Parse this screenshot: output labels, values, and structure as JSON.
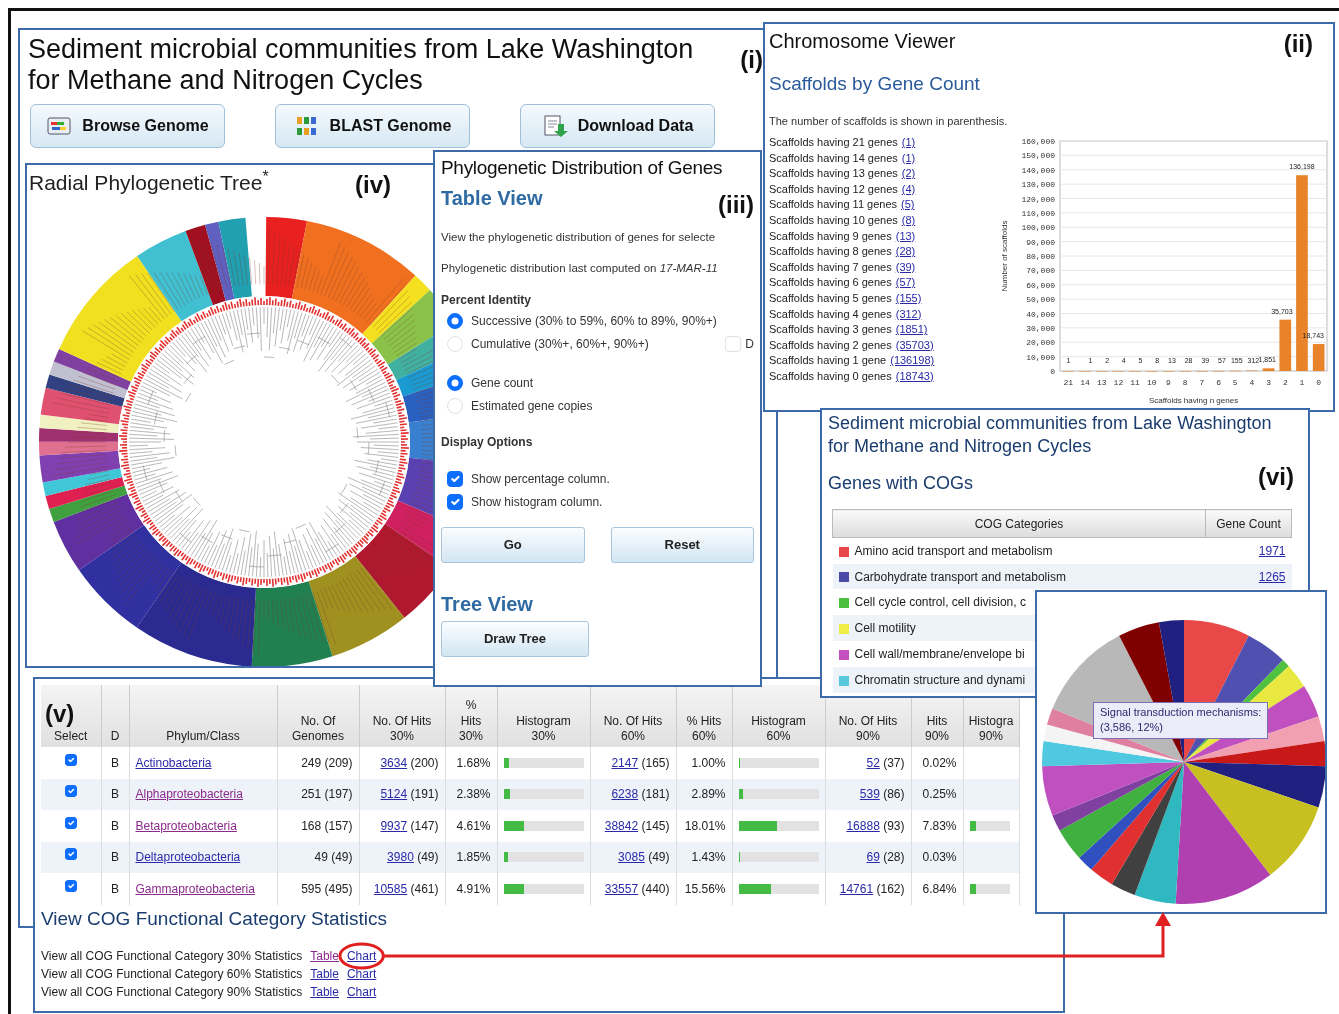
{
  "genome_panel": {
    "title_lines": [
      "Sediment microbial communities from Lake Washington",
      "for Methane and Nitrogen Cycles"
    ],
    "label": "(i)",
    "buttons": [
      {
        "label": "Browse Genome",
        "kind": "browse"
      },
      {
        "label": "BLAST Genome",
        "kind": "blast"
      },
      {
        "label": "Download Data",
        "kind": "download"
      }
    ]
  },
  "radial_tree": {
    "title": "Radial Phylogenetic Tree$^{*}$",
    "label": "(iv)"
  },
  "chromosome_viewer": {
    "title": "Chromosome Viewer",
    "label": "(ii)",
    "heading": "Scaffolds by Gene Count",
    "note": "The number of scaffolds is shown in parenthesis.",
    "scaffolds": [
      {
        "text": "Scaffolds having 21 genes",
        "count": "(1)"
      },
      {
        "text": "Scaffolds having 14 genes",
        "count": "(1)"
      },
      {
        "text": "Scaffolds having 13 genes",
        "count": "(2)"
      },
      {
        "text": "Scaffolds having 12 genes",
        "count": "(4)"
      },
      {
        "text": "Scaffolds having 11 genes",
        "count": "(5)"
      },
      {
        "text": "Scaffolds having 10 genes",
        "count": "(8)"
      },
      {
        "text": "Scaffolds having 9 genes",
        "count": "(13)"
      },
      {
        "text": "Scaffolds having 8 genes",
        "count": "(28)"
      },
      {
        "text": "Scaffolds having 7 genes",
        "count": "(39)"
      },
      {
        "text": "Scaffolds having 6 genes",
        "count": "(57)"
      },
      {
        "text": "Scaffolds having 5 genes",
        "count": "(155)"
      },
      {
        "text": "Scaffolds having 4 genes",
        "count": "(312)"
      },
      {
        "text": "Scaffolds having 3 genes",
        "count": "(1851)"
      },
      {
        "text": "Scaffolds having 2 genes",
        "count": "(35703)"
      },
      {
        "text": "Scaffolds having 1 gene",
        "count": "(136198)"
      },
      {
        "text": "Scaffolds having 0 genes",
        "count": "(18743)"
      }
    ],
    "chart_data": {
      "type": "bar",
      "xlabel": "Scaffolds having n genes",
      "ylabel": "Number of scaffolds",
      "categories": [
        "21",
        "14",
        "13",
        "12",
        "11",
        "10",
        "9",
        "8",
        "7",
        "6",
        "5",
        "4",
        "3",
        "2",
        "1",
        "0"
      ],
      "values": [
        1,
        1,
        2,
        4,
        5,
        8,
        13,
        28,
        39,
        57,
        155,
        312,
        1851,
        35703,
        136198,
        18743
      ],
      "ylim": [
        0,
        160000
      ],
      "grid": true,
      "yticks": [
        {
          "value": 0,
          "label": "0"
        },
        {
          "value": 10000,
          "label": "10,000"
        },
        {
          "value": 20000,
          "label": "20,000"
        },
        {
          "value": 30000,
          "label": "30,000"
        },
        {
          "value": 40000,
          "label": "40,000"
        },
        {
          "value": 50000,
          "label": "50,000"
        },
        {
          "value": 60000,
          "label": "60,000"
        },
        {
          "value": 70000,
          "label": "70,000"
        },
        {
          "value": 80000,
          "label": "80,000"
        },
        {
          "value": 90000,
          "label": "90,000"
        },
        {
          "value": 100000,
          "label": "100,000"
        },
        {
          "value": 110000,
          "label": "110,000"
        },
        {
          "value": 120000,
          "label": "120,000"
        },
        {
          "value": 130000,
          "label": "130,000"
        },
        {
          "value": 140000,
          "label": "140,000"
        },
        {
          "value": 150000,
          "label": "150,000"
        },
        {
          "value": 160000,
          "label": "160,000"
        }
      ],
      "value_labels": [
        "1",
        "1",
        "2",
        "4",
        "5",
        "8",
        "13",
        "28",
        "39",
        "57",
        "155",
        "312",
        "1,851",
        "35,703",
        "136,198",
        "18,743"
      ]
    }
  },
  "phylo_distribution": {
    "title": "Phylogenetic Distribution of Genes",
    "table_view": "Table View",
    "label": "(iii)",
    "intro": "View the phylogenetic distribution of genes for selecte",
    "computed": "Phylogenetic distribution last computed on *17-MAR-11*",
    "percent_identity": "Percent Identity",
    "identity_options": [
      {
        "label": "Successive (30% to 59%, 60% to 89%, 90%+)",
        "selected": true
      },
      {
        "label": "Cumulative (30%+, 60%+, 90%+)",
        "selected": false
      }
    ],
    "side_checkbox": {
      "label": "D",
      "checked": false
    },
    "count_options": [
      {
        "label": "Gene count",
        "selected": true
      },
      {
        "label": "Estimated gene copies",
        "selected": false
      }
    ],
    "display_options": "Display Options",
    "display_checks": [
      {
        "label": "Show percentage column.",
        "checked": true
      },
      {
        "label": "Show histogram column.",
        "checked": true
      }
    ],
    "buttons": [
      "Go",
      "Reset"
    ],
    "tree_view": "Tree View",
    "tree_button": "Draw Tree"
  },
  "phylum_table": {
    "label": "(v)",
    "columns": [
      "Select",
      "D",
      "Phylum/Class",
      "No. Of\nGenomes",
      "No. Of Hits\n30%",
      "%\nHits\n30%",
      "Histogram\n30%",
      "No. Of Hits\n60%",
      "% Hits\n60%",
      "Histogram\n60%",
      "No. Of Hits\n90%",
      "Hits\n90%",
      "Histogra\n90%"
    ],
    "rows": [
      {
        "checked": true,
        "domain": "B",
        "phylum": "Actinobacteria",
        "visited": false,
        "genomes": "249 (209)",
        "hits_30": "3634",
        "count_30": "(200)",
        "pct_30": "1.68%",
        "hist_30": {
          "level": 0.07
        },
        "hits_60": "2147",
        "count_60": "(165)",
        "pct_60": "1.00%",
        "hist_60": {
          "level": 0.02
        },
        "hits_90": "52",
        "count_90": "(37)",
        "pct_90": "0.02%"
      },
      {
        "checked": true,
        "domain": "B",
        "phylum": "Alphaproteobacteria",
        "visited": true,
        "genomes": "251 (197)",
        "hits_30": "5124",
        "count_30": "(191)",
        "pct_30": "2.38%",
        "hist_30": {
          "level": 0.08
        },
        "hits_60": "6238",
        "count_60": "(181)",
        "pct_60": "2.89%",
        "hist_60": {
          "level": 0.06
        },
        "hits_90": "539",
        "count_90": "(86)",
        "pct_90": "0.25%"
      },
      {
        "checked": true,
        "domain": "B",
        "phylum": "Betaproteobacteria",
        "visited": true,
        "genomes": "168 (157)",
        "hits_30": "9937",
        "count_30": "(147)",
        "pct_30": "4.61%",
        "hist_30": {
          "level": 0.25
        },
        "hits_60": "38842",
        "count_60": "(145)",
        "pct_60": "18.01%",
        "hist_60": {
          "level": 0.48
        },
        "hits_90": "16888",
        "count_90": "(93)",
        "pct_90": "7.83%",
        "hist_90": {
          "level": 0.15
        }
      },
      {
        "checked": true,
        "domain": "B",
        "phylum": "Deltaproteobacteria",
        "visited": false,
        "genomes": "49 (49)",
        "hits_30": "3980",
        "count_30": "(49)",
        "pct_30": "1.85%",
        "hist_30": {
          "level": 0.06
        },
        "hits_60": "3085",
        "count_60": "(49)",
        "pct_60": "1.43%",
        "hist_60": {
          "level": 0.02
        },
        "hits_90": "69",
        "count_90": "(28)",
        "pct_90": "0.03%"
      },
      {
        "checked": true,
        "domain": "B",
        "phylum": "Gammaproteobacteria",
        "visited": true,
        "genomes": "595 (495)",
        "hits_30": "10585",
        "count_30": "(461)",
        "pct_30": "4.91%",
        "hist_30": {
          "level": 0.25
        },
        "hits_60": "33557",
        "count_60": "(440)",
        "pct_60": "15.56%",
        "hist_60": {
          "level": 0.4
        },
        "hits_90": "14761",
        "count_90": "(162)",
        "pct_90": "6.84%",
        "hist_90": {
          "level": 0.15
        }
      }
    ]
  },
  "cog_stats": {
    "heading": "View COG Functional Category Statistics",
    "lines": [
      {
        "text": "View all COG Functional Category 30% Statistics",
        "table": "Table",
        "table_visited": true,
        "chart": "Chart",
        "highlighted": true
      },
      {
        "text": "View all COG Functional Category 60% Statistics",
        "table": "Table",
        "table_visited": false,
        "chart": "Chart",
        "highlighted": false
      },
      {
        "text": "View all COG Functional Category 90% Statistics",
        "table": "Table",
        "table_visited": false,
        "chart": "Chart",
        "highlighted": false
      }
    ]
  },
  "cog_panel": {
    "title_lines": [
      "Sediment microbial communities from Lake Washington",
      "for Methane and Nitrogen Cycles"
    ],
    "subtitle": "Genes with COGs",
    "label": "(vi)",
    "columns": [
      "COG Categories",
      "Gene Count"
    ],
    "rows": [
      {
        "color": "#e84848",
        "category": "Amino acid transport and metabolism",
        "count": "1971"
      },
      {
        "color": "#4a4aa8",
        "category": "Carbohydrate transport and metabolism",
        "count": "1265"
      },
      {
        "color": "#4cbf3c",
        "category": "Cell cycle control, cell division, c"
      },
      {
        "color": "#eeee44",
        "category": "Cell motility"
      },
      {
        "color": "#c450c0",
        "category": "Cell wall/membrane/envelope bi"
      },
      {
        "color": "#58c8dc",
        "category": "Chromatin structure and dynami"
      }
    ]
  },
  "pie_chart": {
    "tooltip_lines": [
      "Signal transduction mechanisms:",
      "(3,586, 12%)"
    ]
  }
}
